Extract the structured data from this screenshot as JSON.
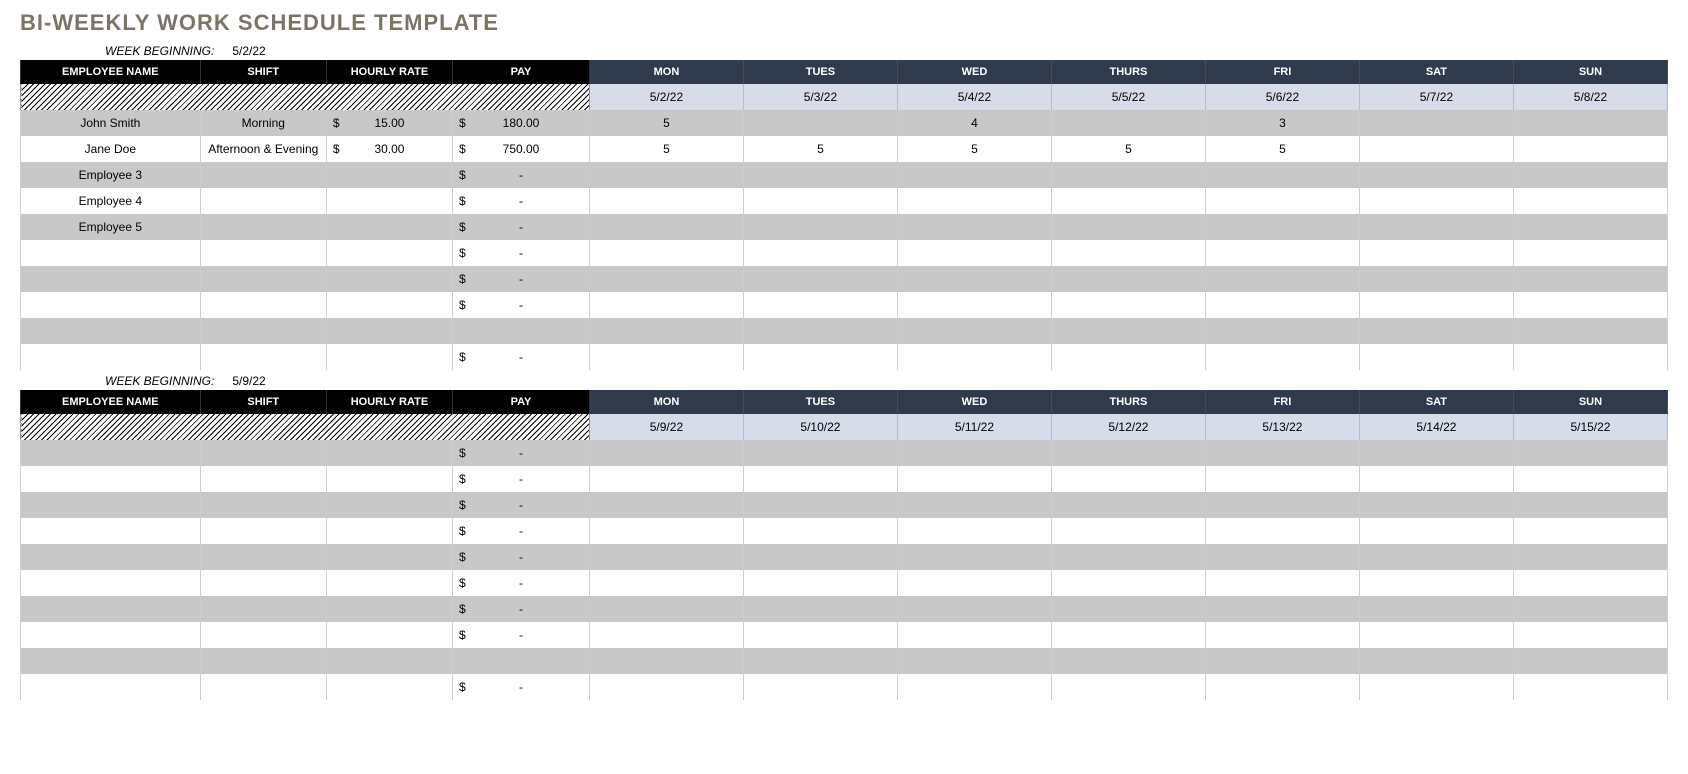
{
  "title": "BI-WEEKLY WORK SCHEDULE TEMPLATE",
  "week_begin_label": "WEEK BEGINNING:",
  "headers": {
    "emp": "EMPLOYEE NAME",
    "shift": "SHIFT",
    "rate": "HOURLY RATE",
    "pay": "PAY",
    "mon": "MON",
    "tue": "TUES",
    "wed": "WED",
    "thu": "THURS",
    "fri": "FRI",
    "sat": "SAT",
    "sun": "SUN"
  },
  "weeks": [
    {
      "beginning": "5/2/22",
      "dates": [
        "5/2/22",
        "5/3/22",
        "5/4/22",
        "5/5/22",
        "5/6/22",
        "5/7/22",
        "5/8/22"
      ],
      "rows": [
        {
          "emp": "John Smith",
          "shift": "Morning",
          "rate": "15.00",
          "pay": "180.00",
          "days": [
            "5",
            "",
            "4",
            "",
            "3",
            "",
            ""
          ]
        },
        {
          "emp": "Jane Doe",
          "shift": "Afternoon & Evening",
          "rate": "30.00",
          "pay": "750.00",
          "days": [
            "5",
            "5",
            "5",
            "5",
            "5",
            "",
            ""
          ]
        },
        {
          "emp": "Employee 3",
          "shift": "",
          "rate": "",
          "pay": "-",
          "days": [
            "",
            "",
            "",
            "",
            "",
            "",
            ""
          ]
        },
        {
          "emp": "Employee 4",
          "shift": "",
          "rate": "",
          "pay": "-",
          "days": [
            "",
            "",
            "",
            "",
            "",
            "",
            ""
          ]
        },
        {
          "emp": "Employee 5",
          "shift": "",
          "rate": "",
          "pay": "-",
          "days": [
            "",
            "",
            "",
            "",
            "",
            "",
            ""
          ]
        },
        {
          "emp": "",
          "shift": "",
          "rate": "",
          "pay": "-",
          "days": [
            "",
            "",
            "",
            "",
            "",
            "",
            ""
          ]
        },
        {
          "emp": "",
          "shift": "",
          "rate": "",
          "pay": "-",
          "days": [
            "",
            "",
            "",
            "",
            "",
            "",
            ""
          ]
        },
        {
          "emp": "",
          "shift": "",
          "rate": "",
          "pay": "-",
          "days": [
            "",
            "",
            "",
            "",
            "",
            "",
            ""
          ]
        },
        {
          "emp": "",
          "shift": "",
          "rate": "",
          "pay": "",
          "days": [
            "",
            "",
            "",
            "",
            "",
            "",
            ""
          ]
        },
        {
          "emp": "",
          "shift": "",
          "rate": "",
          "pay": "-",
          "days": [
            "",
            "",
            "",
            "",
            "",
            "",
            ""
          ]
        }
      ]
    },
    {
      "beginning": "5/9/22",
      "dates": [
        "5/9/22",
        "5/10/22",
        "5/11/22",
        "5/12/22",
        "5/13/22",
        "5/14/22",
        "5/15/22"
      ],
      "rows": [
        {
          "emp": "",
          "shift": "",
          "rate": "",
          "pay": "-",
          "days": [
            "",
            "",
            "",
            "",
            "",
            "",
            ""
          ]
        },
        {
          "emp": "",
          "shift": "",
          "rate": "",
          "pay": "-",
          "days": [
            "",
            "",
            "",
            "",
            "",
            "",
            ""
          ]
        },
        {
          "emp": "",
          "shift": "",
          "rate": "",
          "pay": "-",
          "days": [
            "",
            "",
            "",
            "",
            "",
            "",
            ""
          ]
        },
        {
          "emp": "",
          "shift": "",
          "rate": "",
          "pay": "-",
          "days": [
            "",
            "",
            "",
            "",
            "",
            "",
            ""
          ]
        },
        {
          "emp": "",
          "shift": "",
          "rate": "",
          "pay": "-",
          "days": [
            "",
            "",
            "",
            "",
            "",
            "",
            ""
          ]
        },
        {
          "emp": "",
          "shift": "",
          "rate": "",
          "pay": "-",
          "days": [
            "",
            "",
            "",
            "",
            "",
            "",
            ""
          ]
        },
        {
          "emp": "",
          "shift": "",
          "rate": "",
          "pay": "-",
          "days": [
            "",
            "",
            "",
            "",
            "",
            "",
            ""
          ]
        },
        {
          "emp": "",
          "shift": "",
          "rate": "",
          "pay": "-",
          "days": [
            "",
            "",
            "",
            "",
            "",
            "",
            ""
          ]
        },
        {
          "emp": "",
          "shift": "",
          "rate": "",
          "pay": "",
          "days": [
            "",
            "",
            "",
            "",
            "",
            "",
            ""
          ]
        },
        {
          "emp": "",
          "shift": "",
          "rate": "",
          "pay": "-",
          "days": [
            "",
            "",
            "",
            "",
            "",
            "",
            ""
          ]
        }
      ]
    }
  ]
}
